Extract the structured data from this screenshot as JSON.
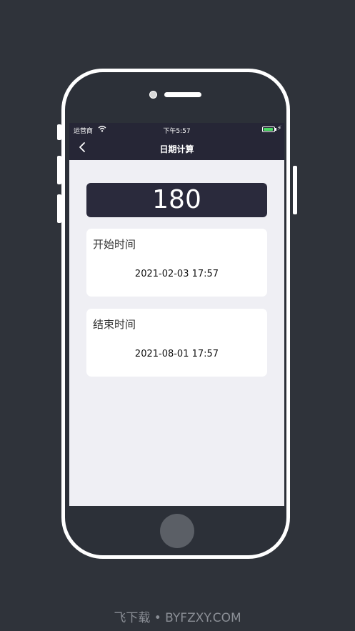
{
  "status_bar": {
    "carrier": "运营商",
    "time": "下午5:57",
    "battery_level": 0.9,
    "battery_color": "#4cd964",
    "charging_icon": "bolt-icon",
    "charging_glyph": "⚡"
  },
  "nav": {
    "title": "日期计算",
    "back_icon": "chevron-left-icon"
  },
  "result": {
    "value": "180"
  },
  "start": {
    "label": "开始时间",
    "value": "2021-02-03 17:57"
  },
  "end": {
    "label": "结束时间",
    "value": "2021-08-01 17:57"
  },
  "watermark": {
    "text": "飞下载 • BYFZXY.COM"
  },
  "colors": {
    "background": "#2f333a",
    "bar": "#262636",
    "result_bg": "#2a2a3c",
    "screen_bg": "#efeff4"
  }
}
